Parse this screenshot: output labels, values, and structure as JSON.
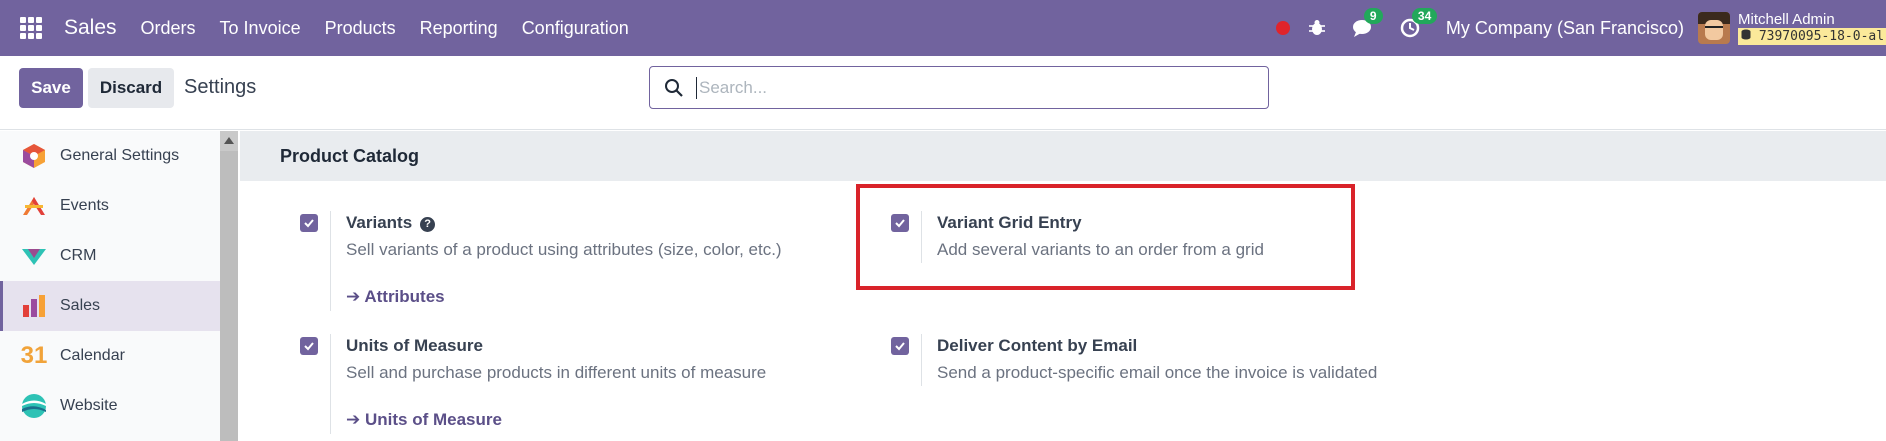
{
  "navbar": {
    "app_name": "Sales",
    "menu": [
      "Orders",
      "To Invoice",
      "Products",
      "Reporting",
      "Configuration"
    ],
    "messages_count": "9",
    "activities_count": "34",
    "company": "My Company (San Francisco)",
    "user_name": "Mitchell Admin",
    "db_name": "73970095-18-0-al",
    "bg_color": "#71639e"
  },
  "control": {
    "save_label": "Save",
    "discard_label": "Discard",
    "breadcrumb": "Settings",
    "search_placeholder": "Search..."
  },
  "sidebar": {
    "items": [
      {
        "label": "General Settings",
        "icon": "general-settings-icon"
      },
      {
        "label": "Events",
        "icon": "events-icon"
      },
      {
        "label": "CRM",
        "icon": "crm-icon"
      },
      {
        "label": "Sales",
        "icon": "sales-icon",
        "active": true
      },
      {
        "label": "Calendar",
        "icon": "calendar-icon",
        "icon_text": "31"
      },
      {
        "label": "Website",
        "icon": "website-icon"
      }
    ]
  },
  "section": {
    "title": "Product Catalog",
    "settings": [
      {
        "title": "Variants",
        "desc": "Sell variants of a product using attributes (size, color, etc.)",
        "link": "Attributes",
        "checked": true
      },
      {
        "title": "Variant Grid Entry",
        "desc": "Add several variants to an order from a grid",
        "checked": true
      },
      {
        "title": "Units of Measure",
        "desc": "Sell and purchase products in different units of measure",
        "link": "Units of Measure",
        "checked": true
      },
      {
        "title": "Deliver Content by Email",
        "desc": "Send a product-specific email once the invoice is validated",
        "checked": true
      }
    ],
    "help_glyph": "?",
    "link_arrow": "➔"
  }
}
